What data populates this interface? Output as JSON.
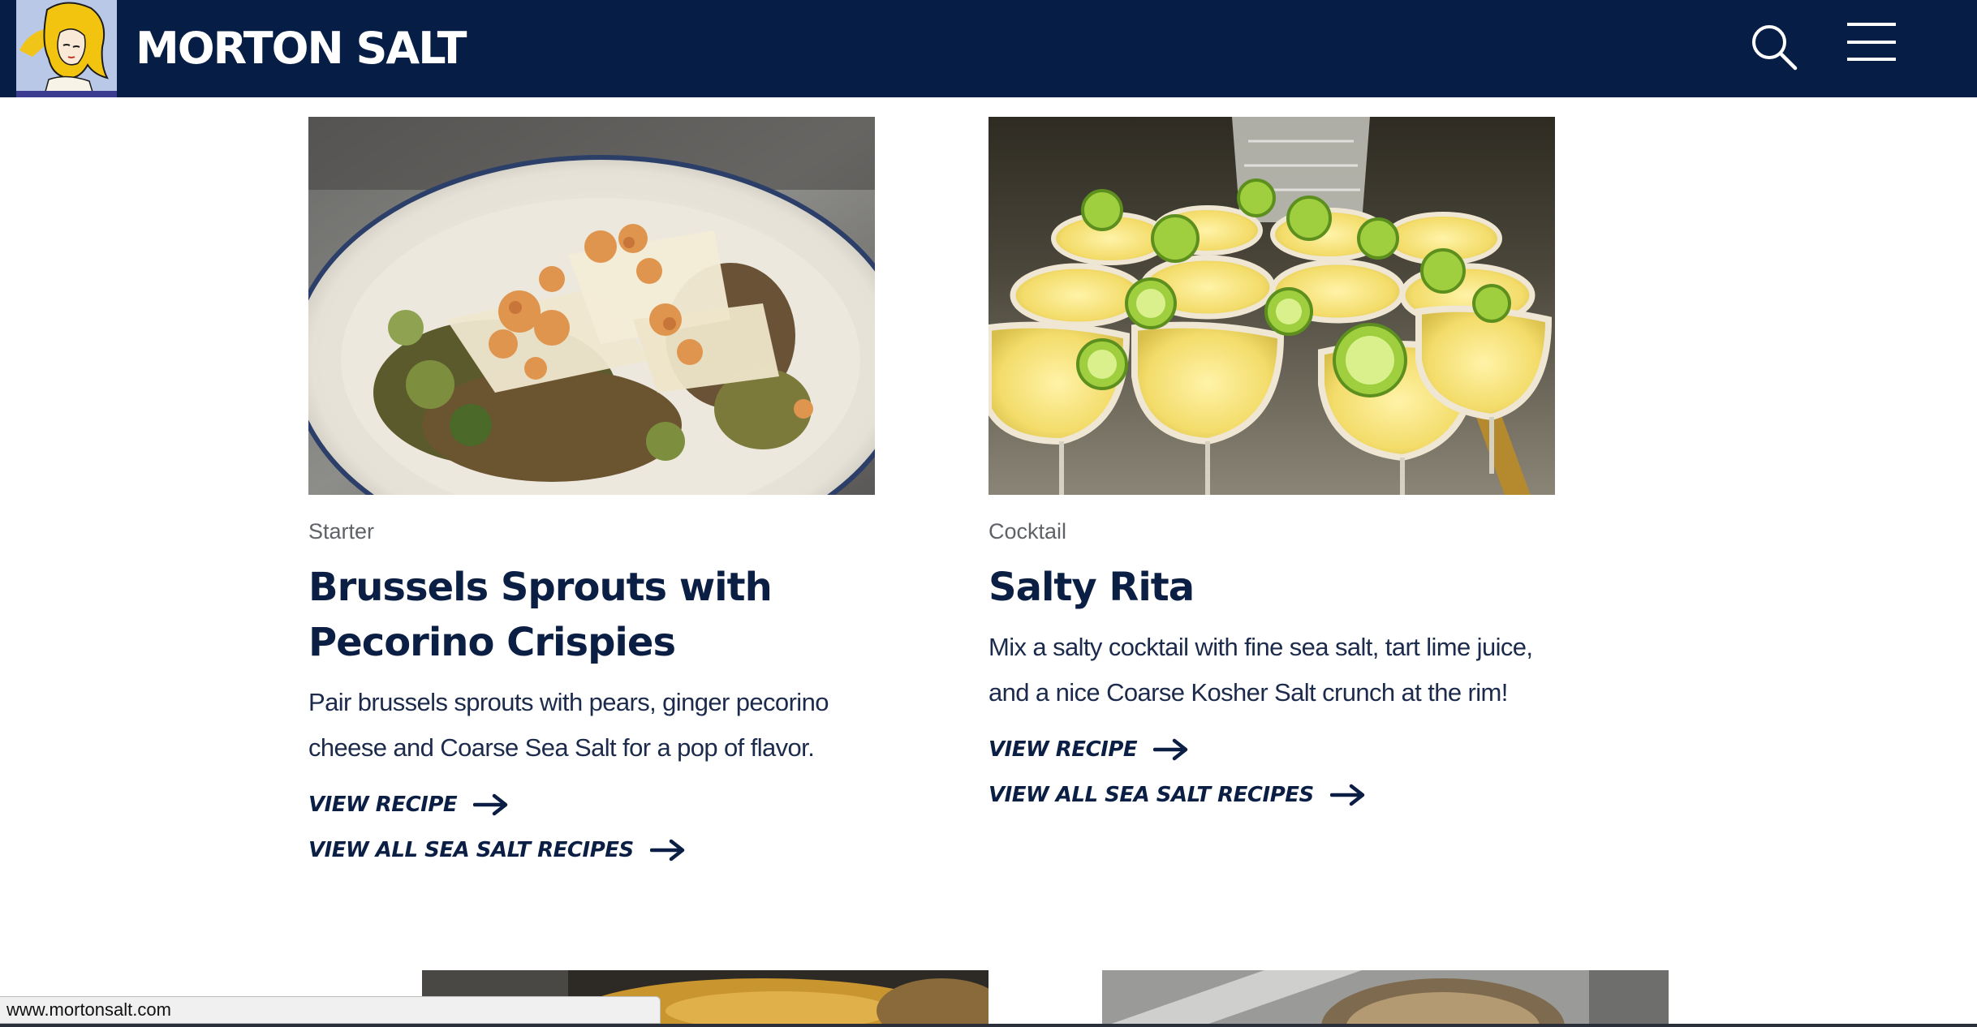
{
  "header": {
    "brand": "MORTON SALT",
    "logo_icon": "morton-salt-girl-icon",
    "search_icon": "search-icon",
    "menu_icon": "hamburger-menu-icon",
    "background_color": "#061d45"
  },
  "cards": [
    {
      "image_subject": "brussels sprouts with pecorino crispies plate",
      "category": "Starter",
      "title": "Brussels Sprouts with Pecorino Crispies",
      "description": "Pair brussels sprouts with pears, ginger pecorino cheese and Coarse Sea Salt for a pop of flavor.",
      "link_recipe": "VIEW RECIPE",
      "link_all": "VIEW ALL SEA SALT RECIPES"
    },
    {
      "image_subject": "salt-rimmed margarita glasses with lime wheels",
      "category": "Cocktail",
      "title": "Salty Rita",
      "description": "Mix a salty cocktail with fine sea salt, tart lime juice, and a nice Coarse Kosher Salt crunch at the rim!",
      "link_recipe": "VIEW RECIPE",
      "link_all": "VIEW ALL SEA SALT RECIPES"
    }
  ],
  "status_bar": {
    "url": "www.mortonsalt.com"
  },
  "colors": {
    "navy": "#061d45",
    "title": "#0b1f44",
    "category": "#5f6267",
    "body": "#1c2b4c"
  }
}
